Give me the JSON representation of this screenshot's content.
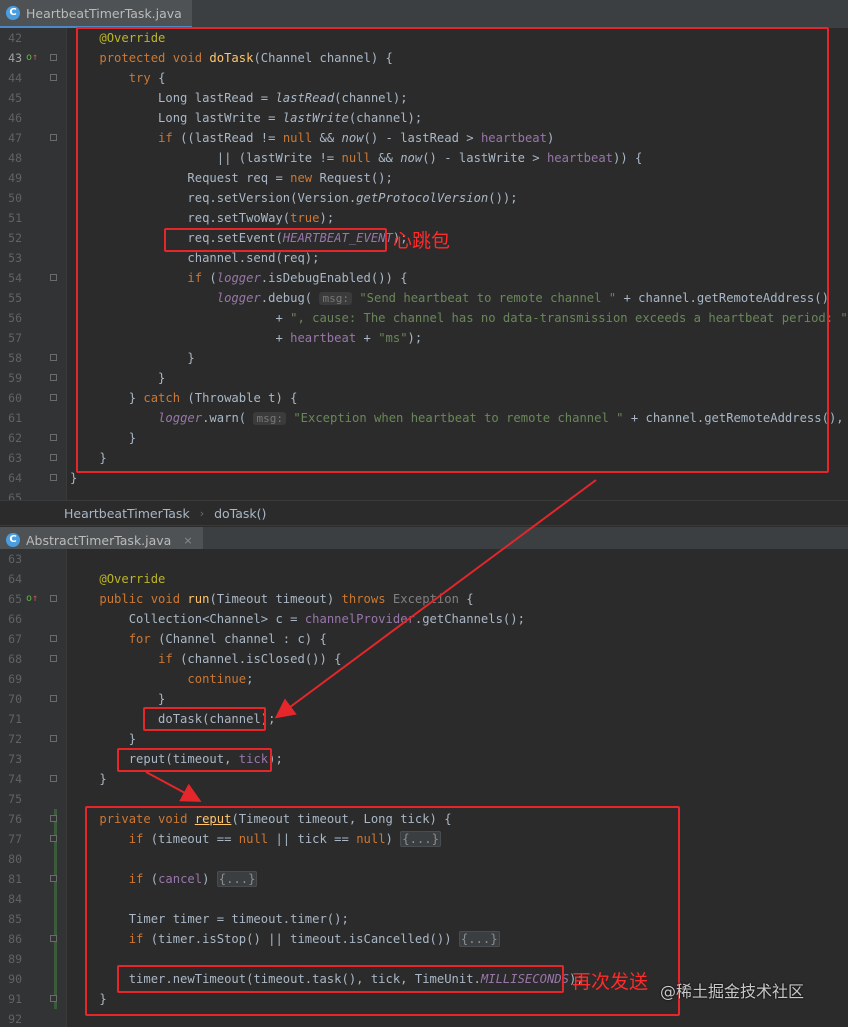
{
  "tab1": {
    "icon": "C",
    "title": "HeartbeatTimerTask.java"
  },
  "tab2": {
    "icon": "C",
    "title": "AbstractTimerTask.java",
    "close": "×"
  },
  "breadcrumb": {
    "items": [
      "HeartbeatTimerTask",
      "doTask()"
    ],
    "separator": "›"
  },
  "annotations": {
    "heartbeat": "心跳包",
    "resend": "再次发送"
  },
  "watermark": "@稀土掘金技术社区",
  "editor1": {
    "lines": [
      {
        "n": "42",
        "code": "    <span class=\"ann\">@Override</span>"
      },
      {
        "n": "43",
        "code": "    <span class=\"kw\">protected void </span><span class=\"fn\">doTask</span>(Channel channel) {",
        "mark": true,
        "current": true,
        "fold": true
      },
      {
        "n": "44",
        "code": "        <span class=\"kw\">try </span>{",
        "fold": true
      },
      {
        "n": "45",
        "code": "            Long lastRead = <span class=\"it\">lastRead</span>(channel);"
      },
      {
        "n": "46",
        "code": "            Long lastWrite = <span class=\"it\">lastWrite</span>(channel);"
      },
      {
        "n": "47",
        "code": "            <span class=\"kw\">if </span>((lastRead != <span class=\"kw\">null </span>&amp;&amp; <span class=\"it\">now</span>() - lastRead &gt; <span class=\"fld\">heartbeat</span>)",
        "fold": true
      },
      {
        "n": "48",
        "code": "                    || (lastWrite != <span class=\"kw\">null </span>&amp;&amp; <span class=\"it\">now</span>() - lastWrite &gt; <span class=\"fld\">heartbeat</span>)) {"
      },
      {
        "n": "49",
        "code": "                Request req = <span class=\"kw\">new </span>Request();"
      },
      {
        "n": "50",
        "code": "                req.setVersion(Version.<span class=\"it\">getProtocolVersion</span>());"
      },
      {
        "n": "51",
        "code": "                req.setTwoWay(<span class=\"kw\">true</span>);"
      },
      {
        "n": "52",
        "code": "                req.setEvent(<span class=\"const\">HEARTBEAT_EVENT</span>);"
      },
      {
        "n": "53",
        "code": "                channel.send(req);"
      },
      {
        "n": "54",
        "code": "                <span class=\"kw\">if </span>(<span class=\"const\">logger</span>.isDebugEnabled()) {",
        "fold": true
      },
      {
        "n": "55",
        "code": "                    <span class=\"const\">logger</span>.debug( <span class=\"hint\">msg:</span> <span class=\"str\">\"Send heartbeat to remote channel \"</span> + channel.getRemoteAddress()"
      },
      {
        "n": "56",
        "code": "                            + <span class=\"str\">\", cause: The channel has no data-transmission exceeds a heartbeat period: \"</span>"
      },
      {
        "n": "57",
        "code": "                            + <span class=\"fld\">heartbeat</span> + <span class=\"str\">\"ms\"</span>);"
      },
      {
        "n": "58",
        "code": "                }",
        "fold": true
      },
      {
        "n": "59",
        "code": "            }",
        "fold": true
      },
      {
        "n": "60",
        "code": "        } <span class=\"kw\">catch </span>(Throwable t) {",
        "fold": true
      },
      {
        "n": "61",
        "code": "            <span class=\"const\">logger</span>.warn( <span class=\"hint\">msg:</span> <span class=\"str\">\"Exception when heartbeat to remote channel \"</span> + channel.getRemoteAddress(), t);"
      },
      {
        "n": "62",
        "code": "        }",
        "fold": true
      },
      {
        "n": "63",
        "code": "    }",
        "fold": true
      },
      {
        "n": "64",
        "code": "}",
        "fold": true
      },
      {
        "n": "65",
        "code": ""
      }
    ]
  },
  "editor2": {
    "lines": [
      {
        "n": "63",
        "code": ""
      },
      {
        "n": "64",
        "code": "    <span class=\"ann\">@Override</span>"
      },
      {
        "n": "65",
        "code": "    <span class=\"kw\">public void </span><span class=\"fn\">run</span>(Timeout timeout) <span class=\"kw\">throws </span><span class=\"gray\">Exception</span> {",
        "mark": true,
        "fold": true
      },
      {
        "n": "66",
        "code": "        Collection&lt;Channel&gt; c = <span class=\"fld\">channelProvider</span>.getChannels();"
      },
      {
        "n": "67",
        "code": "        <span class=\"kw\">for </span>(Channel channel : c) {",
        "fold": true
      },
      {
        "n": "68",
        "code": "            <span class=\"kw\">if </span>(channel.isClosed()) {",
        "fold": true
      },
      {
        "n": "69",
        "code": "                <span class=\"kw\">continue</span>;"
      },
      {
        "n": "70",
        "code": "            }",
        "fold": true
      },
      {
        "n": "71",
        "code": "            doTask(channel);"
      },
      {
        "n": "72",
        "code": "        }",
        "fold": true
      },
      {
        "n": "73",
        "code": "        reput(timeout, <span class=\"fld\">tick</span>);"
      },
      {
        "n": "74",
        "code": "    }",
        "fold": true
      },
      {
        "n": "75",
        "code": ""
      },
      {
        "n": "76",
        "code": "    <span class=\"kw\">private void </span><span class=\"fn\" style=\"text-decoration:underline;\">reput</span>(Timeout timeout, Long tick) {",
        "fold": true
      },
      {
        "n": "77",
        "code": "        <span class=\"kw\">if </span>(timeout == <span class=\"kw\">null </span>|| tick == <span class=\"kw\">null</span>) <span class=\"folded\">{...}</span>",
        "fold": true
      },
      {
        "n": "80",
        "code": ""
      },
      {
        "n": "81",
        "code": "        <span class=\"kw\">if </span>(<span class=\"fld\">cancel</span>) <span class=\"folded\">{...}</span>",
        "fold": true
      },
      {
        "n": "84",
        "code": ""
      },
      {
        "n": "85",
        "code": "        Timer timer = timeout.timer();"
      },
      {
        "n": "86",
        "code": "        <span class=\"kw\">if </span>(timer.isStop() || timeout.isCancelled()) <span class=\"folded\">{...}</span>",
        "fold": true
      },
      {
        "n": "89",
        "code": ""
      },
      {
        "n": "90",
        "code": "        timer.newTimeout(timeout.task(), tick, TimeUnit.<span class=\"const\">MILLISECONDS</span>);"
      },
      {
        "n": "91",
        "code": "    }",
        "fold": true
      },
      {
        "n": "92",
        "code": ""
      }
    ]
  }
}
